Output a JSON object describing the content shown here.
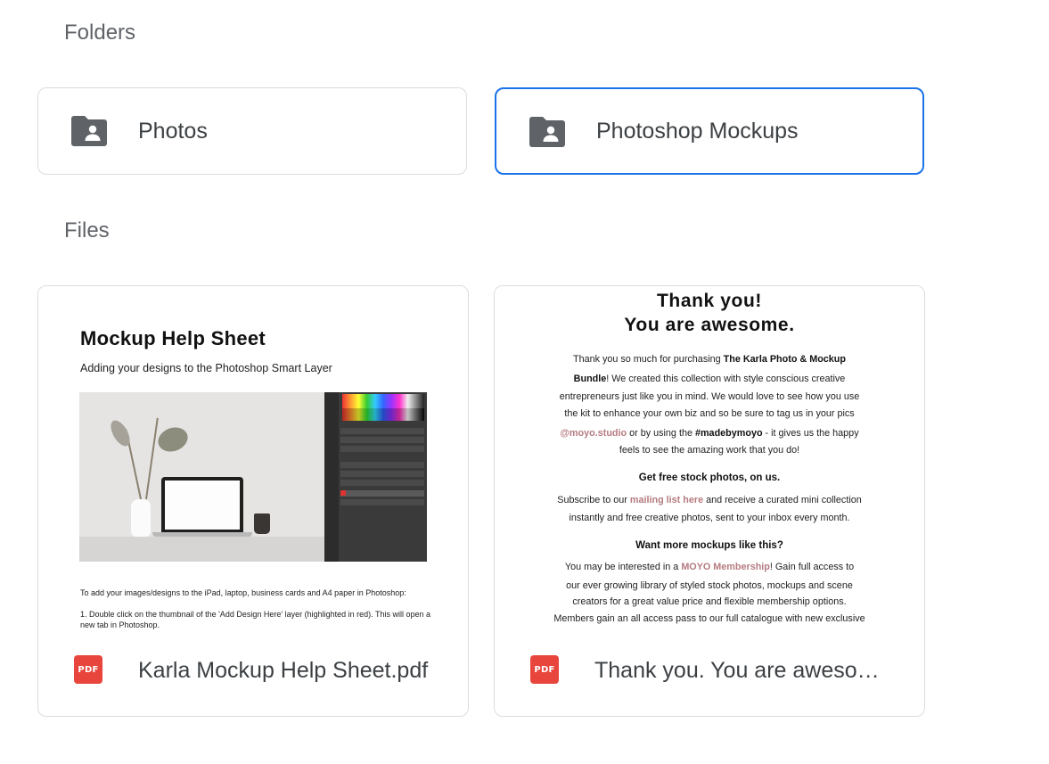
{
  "sections": {
    "folders_label": "Folders",
    "files_label": "Files"
  },
  "folders": [
    {
      "name": "Photos",
      "icon": "shared-folder-icon",
      "selected": false
    },
    {
      "name": "Photoshop Mockups",
      "icon": "shared-folder-icon",
      "selected": true
    }
  ],
  "files": [
    {
      "name": "Karla Mockup Help Sheet.pdf",
      "type_badge": "PDF",
      "icon": "pdf-icon",
      "preview": {
        "title": "Mockup Help Sheet",
        "subtitle": "Adding your designs to the Photoshop Smart Layer",
        "body_1": "To add your images/designs to the iPad, laptop, business cards and A4 paper in Photoshop:",
        "body_2": "1. Double click on the thumbnail of the 'Add Design Here' layer (highlighted in red). This will open a new tab in Photoshop."
      }
    },
    {
      "name": "Thank you. You are aweso…",
      "type_badge": "PDF",
      "icon": "pdf-icon",
      "preview": {
        "title_1": "Thank you!",
        "title_2": "You are awesome.",
        "p1_l1_a": "Thank you so much for purchasing ",
        "p1_l1_b": "The Karla Photo & Mockup",
        "p1_l2_a": "Bundle",
        "p1_l2_b": "! We created this collection with style conscious creative",
        "p1_l3": "entrepreneurs just like you in mind. We would love to see how you use",
        "p1_l4": "the kit to enhance your own biz and so be sure to tag us in your pics",
        "p1_l5_a": "@moyo.studio",
        "p1_l5_b": " or by using the ",
        "p1_l5_c": "#madebymoyo",
        "p1_l5_d": " - it gives us the happy",
        "p1_l6": "feels to see the amazing work that you do!",
        "h2": "Get free stock photos, on us.",
        "p2_l1_a": "Subscribe to our ",
        "p2_l1_b": "mailing list here",
        "p2_l1_c": " and receive a curated mini collection",
        "p2_l2": "instantly and free creative photos, sent to your inbox every month.",
        "h3": "Want more mockups like this?",
        "p3_l1_a": "You may be interested in a ",
        "p3_l1_b": "MOYO Membership",
        "p3_l1_c": "! Gain full access to",
        "p3_l2": "our ever growing library of styled stock photos, mockups and scene",
        "p3_l3": "creators for a great value price and flexible membership options.",
        "p3_l4": "Members gain an all access pass to our full catalogue with new exclusive"
      }
    }
  ],
  "colors": {
    "selected_border": "#1a73e8",
    "card_border": "#dadce0",
    "pdf_red": "#e8453c",
    "link_pink": "#b57b80"
  }
}
